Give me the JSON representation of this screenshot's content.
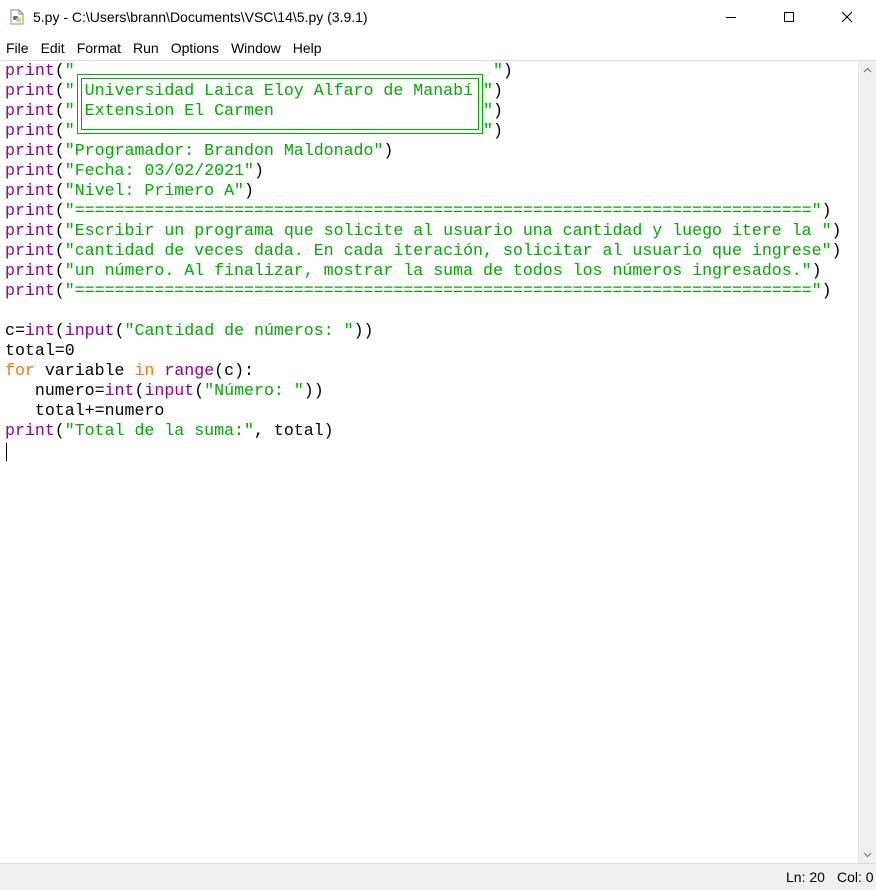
{
  "window": {
    "title": "5.py - C:\\Users\\brann\\Documents\\VSC\\14\\5.py (3.9.1)",
    "app_icon": "python-file-icon",
    "controls": [
      "minimize-icon",
      "maximize-icon",
      "close-icon"
    ]
  },
  "menu": [
    "File",
    "Edit",
    "Format",
    "Run",
    "Options",
    "Window",
    "Help"
  ],
  "colors": {
    "keyword": "#ff7700",
    "builtin": "#900090",
    "string": "#00aa00",
    "default": "#000000"
  },
  "code": {
    "l1": {
      "fn": "print",
      "a": "(",
      "s": "\"                                          \"",
      "b": ")"
    },
    "l2": {
      "fn": "print",
      "a": "(",
      "s": "\" Universidad Laica Eloy Alfaro de Manabí \"",
      "b": ")"
    },
    "l3": {
      "fn": "print",
      "a": "(",
      "s": "\" Extension El Carmen                     \"",
      "b": ")"
    },
    "l4": {
      "fn": "print",
      "a": "(",
      "s": "\"                                         \"",
      "b": ")"
    },
    "l5": {
      "fn": "print",
      "a": "(",
      "s": "\"Programador: Brandon Maldonado\"",
      "b": ")"
    },
    "l6": {
      "fn": "print",
      "a": "(",
      "s": "\"Fecha: 03/02/2021\"",
      "b": ")"
    },
    "l7": {
      "fn": "print",
      "a": "(",
      "s": "\"Nivel: Primero A\"",
      "b": ")"
    },
    "l8": {
      "fn": "print",
      "a": "(",
      "s": "\"==========================================================================\"",
      "b": ")"
    },
    "l9": {
      "fn": "print",
      "a": "(",
      "s": "\"Escribir un programa que solicite al usuario una cantidad y luego itere la \"",
      "b": ")"
    },
    "l10": {
      "fn": "print",
      "a": "(",
      "s": "\"cantidad de veces dada. En cada iteración, solicitar al usuario que ingrese\"",
      "b": ")"
    },
    "l11": {
      "fn": "print",
      "a": "(",
      "s": "\"un número. Al finalizar, mostrar la suma de todos los números ingresados.\"",
      "b": ")"
    },
    "l12": {
      "fn": "print",
      "a": "(",
      "s": "\"==========================================================================\"",
      "b": ")"
    },
    "l14": {
      "p1": "c=",
      "f1": "int",
      "p2": "(",
      "f2": "input",
      "p3": "(",
      "s": "\"Cantidad de números: \"",
      "p4": "))"
    },
    "l15": {
      "t": "total=0"
    },
    "l16": {
      "k1": "for",
      "p1": " variable ",
      "k2": "in",
      "p2": " ",
      "f": "range",
      "p3": "(c):"
    },
    "l17": {
      "p1": "   numero=",
      "f1": "int",
      "p2": "(",
      "f2": "input",
      "p3": "(",
      "s": "\"Número: \"",
      "p4": "))"
    },
    "l18": {
      "t": "   total+=numero"
    },
    "l19": {
      "fn": "print",
      "a": "(",
      "s": "\"Total de la suma:\"",
      "b": ", total)"
    }
  },
  "status": {
    "ln": "Ln: 20",
    "col": "Col: 0"
  }
}
